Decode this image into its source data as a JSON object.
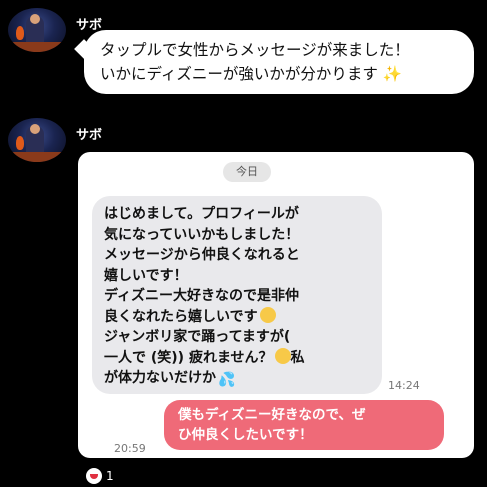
{
  "messages": [
    {
      "user": "サボ",
      "text_lines": [
        "タップルで女性からメッセージが来ました！",
        "いかにディズニーが強いかが分かります"
      ],
      "icon": "sparkles-icon"
    },
    {
      "user": "サボ",
      "screenshot": {
        "date_label": "今日",
        "received_lines": [
          "はじめまして。プロフィールが",
          "気になっていいかもしました！",
          "メッセージから仲良くなれると",
          "嬉しいです！",
          "ディズニー大好きなので是非仲",
          "良くなれたら嬉しいです",
          "ジャンボリ家で踊ってますが(",
          "一人で (笑)) 疲れません？",
          "が体力ないだけか"
        ],
        "received_word_after_laugh": "私",
        "received_time": "14:24",
        "sent_lines": [
          "僕もディズニー好きなので、ぜ",
          "ひ仲良くしたいです！"
        ],
        "sent_time": "20:59"
      }
    }
  ],
  "reaction": {
    "icon": "laughing-face-icon",
    "count": "1"
  }
}
